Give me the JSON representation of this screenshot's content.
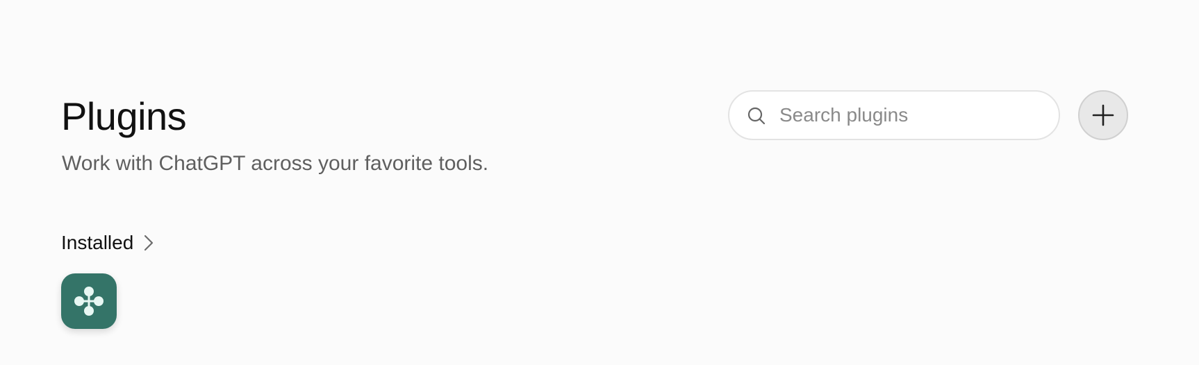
{
  "header": {
    "title": "Plugins",
    "subtitle": "Work with ChatGPT across your favorite tools."
  },
  "search": {
    "placeholder": "Search plugins",
    "value": ""
  },
  "add_button": {
    "icon": "plus-icon"
  },
  "installed": {
    "label": "Installed",
    "chevron_icon": "chevron-right-icon",
    "plugins": [
      {
        "icon": "plugin-cluster-icon",
        "background": "#347468",
        "glyph_color": "#e8f7f3"
      }
    ]
  },
  "colors": {
    "page_background": "#fbfbfb",
    "title_text": "#111111",
    "subtitle_text": "#5f5f5f",
    "placeholder_text": "#8a8a8a",
    "search_border": "#e3e3e3",
    "add_button_background": "#e8e8e8",
    "plugin_tile": "#347468"
  }
}
